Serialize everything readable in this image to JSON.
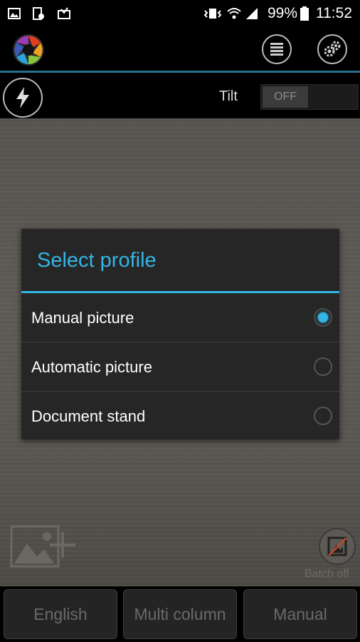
{
  "status_bar": {
    "battery_percent": "99%",
    "time": "11:52",
    "icons": [
      "image-notification-icon",
      "screenshot-notification-icon",
      "inbox-notification-icon",
      "vibrate-icon",
      "wifi-icon",
      "signal-icon",
      "battery-icon"
    ]
  },
  "app_bar": {
    "icons": [
      "aperture-logo-icon",
      "list-menu-icon",
      "settings-gears-icon"
    ]
  },
  "tool_row": {
    "flash_icon": "lightning-icon",
    "tilt_label": "Tilt",
    "tilt_toggle": "OFF"
  },
  "dialog": {
    "title": "Select profile",
    "options": [
      {
        "label": "Manual picture",
        "selected": true
      },
      {
        "label": "Automatic picture",
        "selected": false
      },
      {
        "label": "Document stand",
        "selected": false
      }
    ]
  },
  "preview": {
    "add_image_icon": "add-image-icon",
    "batch_icon": "batch-off-icon",
    "batch_label": "Batch off"
  },
  "bottom_bar": {
    "language": "English",
    "layout": "Multi column",
    "mode": "Manual"
  },
  "colors": {
    "accent": "#33b5e5",
    "dialog_bg": "#262626",
    "bar_bg": "#000000"
  }
}
